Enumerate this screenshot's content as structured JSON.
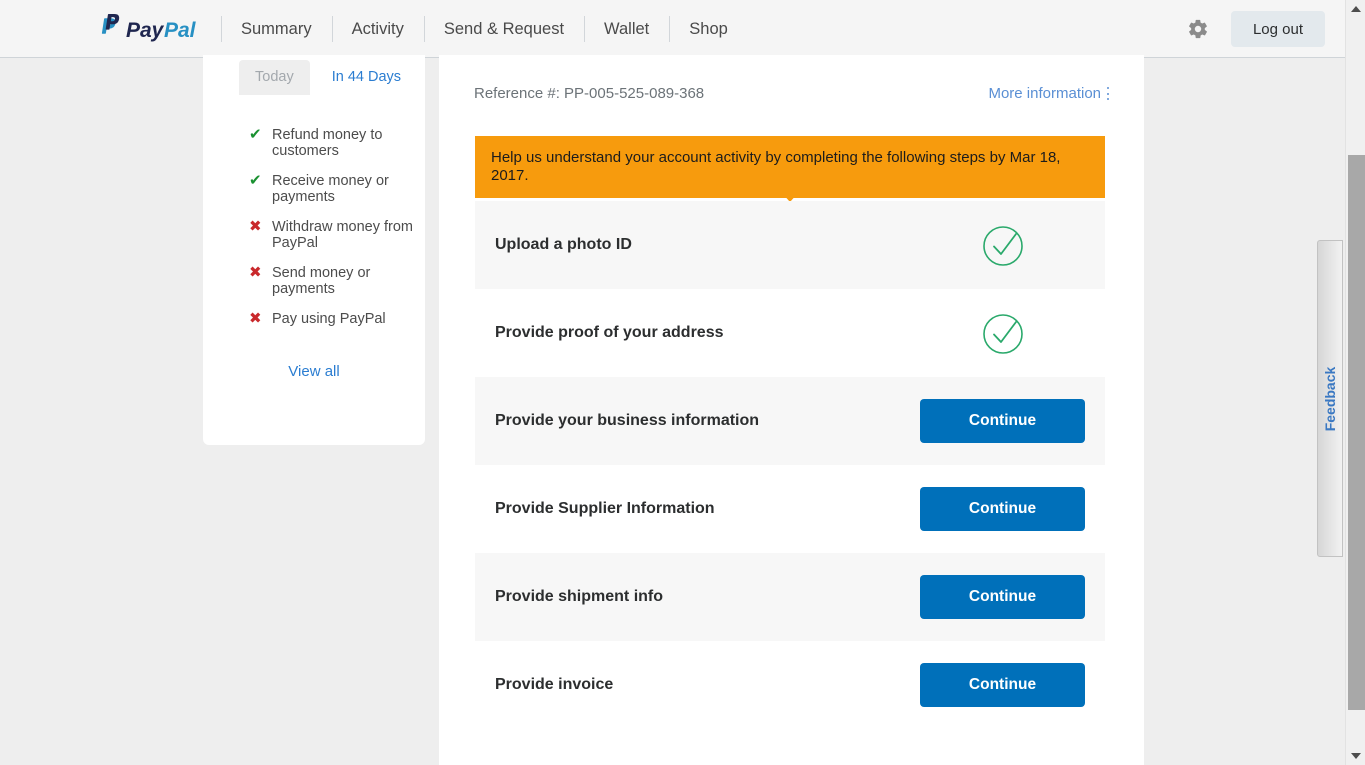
{
  "header": {
    "brand": "PayPal",
    "brand_pay": "Pay",
    "brand_pal": "Pal",
    "nav": [
      {
        "label": "Summary"
      },
      {
        "label": "Activity"
      },
      {
        "label": "Send & Request"
      },
      {
        "label": "Wallet"
      },
      {
        "label": "Shop"
      }
    ],
    "settings_icon": "gear-icon",
    "logout_label": "Log out",
    "bg_color": "#f5f5f5"
  },
  "sidebar": {
    "tabs": [
      {
        "label": "Today",
        "active": false
      },
      {
        "label": "In 44 Days",
        "active": true
      }
    ],
    "permissions": [
      {
        "mark": "✔",
        "status": "allowed",
        "label": "Refund money to customers"
      },
      {
        "mark": "✔",
        "status": "allowed",
        "label": "Receive money or payments"
      },
      {
        "mark": "✖",
        "status": "blocked",
        "label": "Withdraw money from PayPal"
      },
      {
        "mark": "✖",
        "status": "blocked",
        "label": "Send money or payments"
      },
      {
        "mark": "✖",
        "status": "blocked",
        "label": "Pay using PayPal"
      }
    ],
    "view_all_label": "View all",
    "allowed_color": "#1a9131",
    "blocked_color": "#c9292c"
  },
  "main": {
    "reference_label": "Reference #: PP-005-525-089-368",
    "more_information_label": "More information",
    "more_information_icon": "kebab-menu-icon",
    "banner_text": "Help us understand your account activity by completing the following steps by Mar 18, 2017.",
    "banner_color": "#f79b0d",
    "continue_label": "Continue",
    "continue_color": "#0070ba",
    "check_color": "#2aa96b",
    "steps": [
      {
        "label": "Upload a photo ID",
        "state": "complete",
        "shaded": true
      },
      {
        "label": "Provide proof of your address",
        "state": "complete",
        "shaded": false
      },
      {
        "label": "Provide your business information",
        "state": "pending",
        "shaded": true
      },
      {
        "label": "Provide Supplier Information",
        "state": "pending",
        "shaded": false
      },
      {
        "label": "Provide shipment info",
        "state": "pending",
        "shaded": true
      },
      {
        "label": "Provide invoice",
        "state": "pending",
        "shaded": false
      }
    ]
  },
  "feedback": {
    "label": "Feedback",
    "color": "#3a78c2"
  },
  "scrollbar": {
    "up_arrow": "scroll-up-arrow-icon",
    "down_arrow": "scroll-down-arrow-icon"
  }
}
